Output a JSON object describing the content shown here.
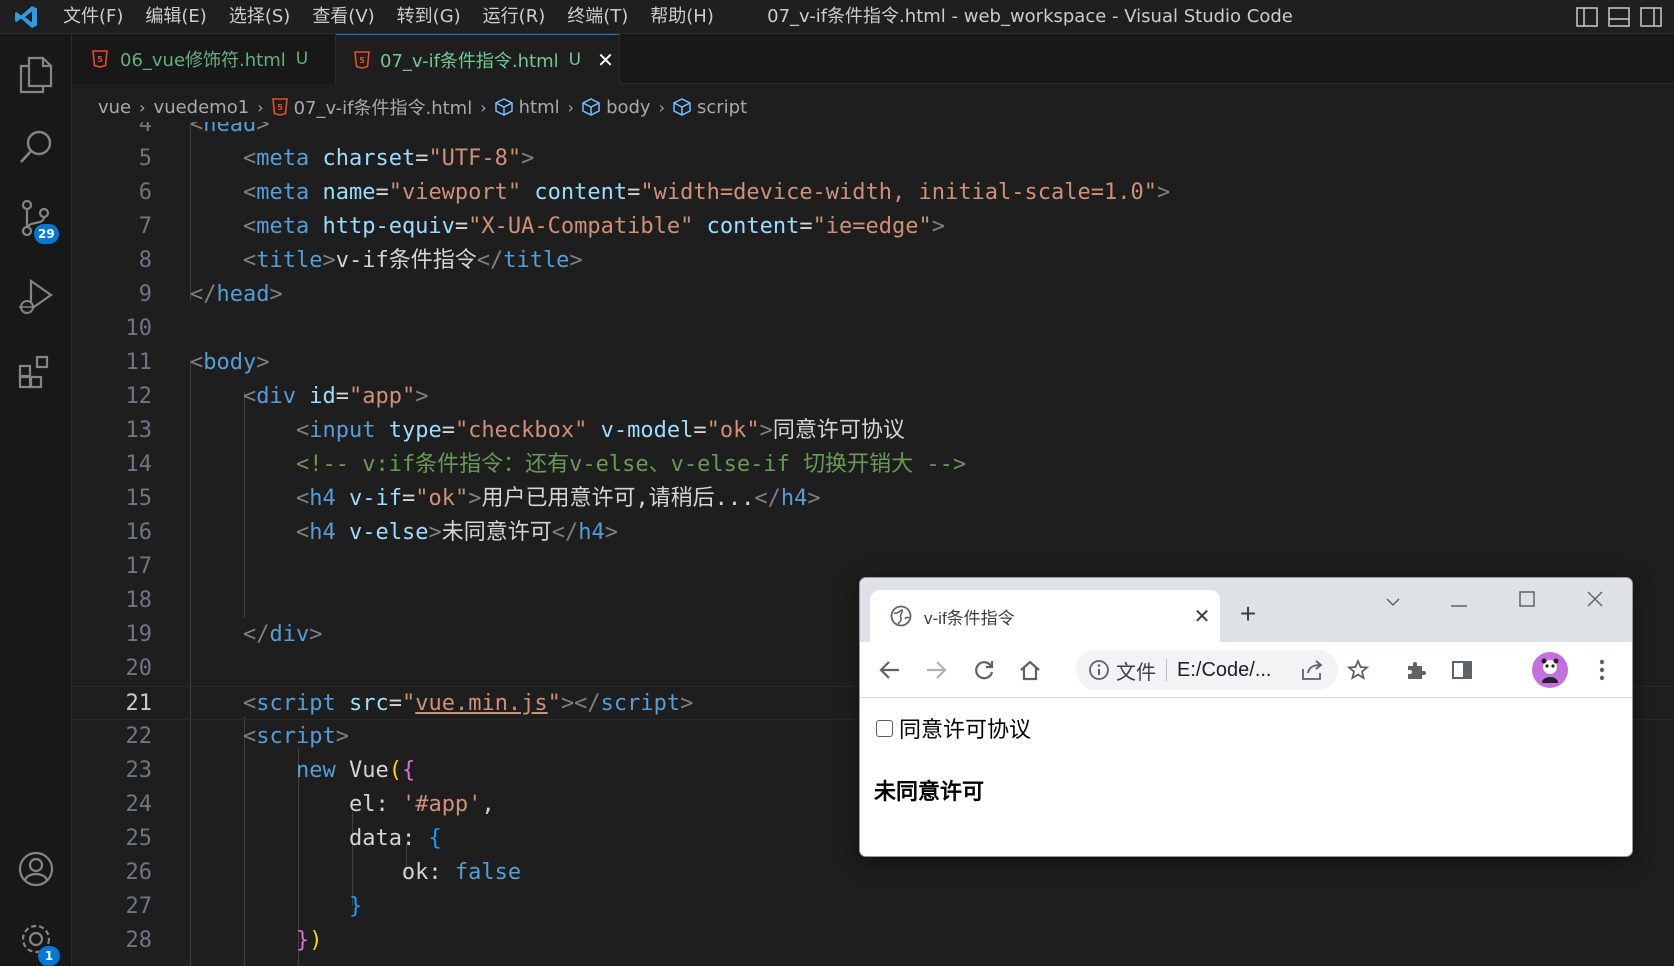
{
  "titlebar": {
    "menu": [
      "文件(F)",
      "编辑(E)",
      "选择(S)",
      "查看(V)",
      "转到(G)",
      "运行(R)",
      "终端(T)",
      "帮助(H)"
    ],
    "window_title": "07_v-if条件指令.html - web_workspace - Visual Studio Code"
  },
  "activitybar": {
    "scm_badge": "29",
    "settings_badge": "1"
  },
  "tabs": [
    {
      "label": "06_vue修饰符.html",
      "status": "U"
    },
    {
      "label": "07_v-if条件指令.html",
      "status": "U",
      "close": "✕"
    }
  ],
  "breadcrumb": [
    "vue",
    "vuedemo1",
    "07_v-if条件指令.html",
    "html",
    "body",
    "script"
  ],
  "editor": {
    "partial_top": "<head>",
    "current_line": 21
  },
  "browser": {
    "tab_title": "v-if条件指令",
    "tab_close": "✕",
    "new_tab": "+",
    "omnibox_chip": "文件",
    "omnibox_url": "E:/Code/...",
    "checkbox_label": "同意许可协议",
    "h4_text": "未同意许可"
  },
  "colors": {
    "accent": "#0078d4",
    "modified_green": "#73c991",
    "html_icon": "#e44d26"
  }
}
